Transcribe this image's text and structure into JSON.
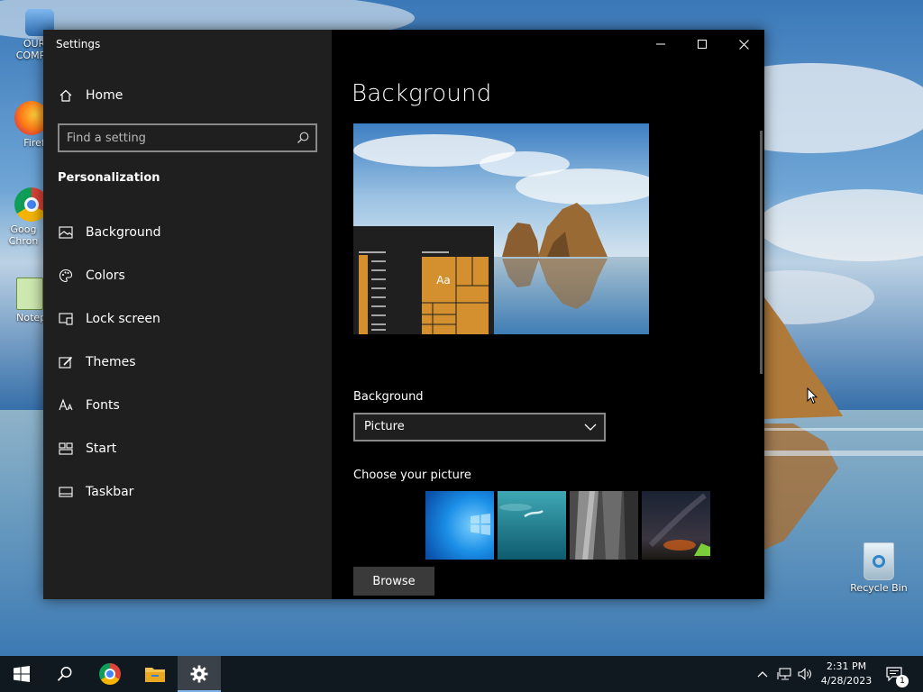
{
  "window": {
    "title": "Settings",
    "minimize_icon": "minimize-icon",
    "maximize_icon": "maximize-icon",
    "close_icon": "close-icon"
  },
  "sidebar": {
    "home": {
      "label": "Home",
      "icon": "home-icon"
    },
    "search": {
      "placeholder": "Find a setting",
      "icon": "search-icon"
    },
    "section_title": "Personalization",
    "items": [
      {
        "label": "Background",
        "icon": "picture-icon",
        "selected": true
      },
      {
        "label": "Colors",
        "icon": "palette-icon"
      },
      {
        "label": "Lock screen",
        "icon": "lock-screen-icon"
      },
      {
        "label": "Themes",
        "icon": "brush-icon"
      },
      {
        "label": "Fonts",
        "icon": "font-icon"
      },
      {
        "label": "Start",
        "icon": "start-tiles-icon"
      },
      {
        "label": "Taskbar",
        "icon": "taskbar-icon"
      }
    ]
  },
  "content": {
    "page_title": "Background",
    "preview": {
      "sample_text": "Aa",
      "accent": "#d4902e"
    },
    "background_label": "Background",
    "background_select": {
      "value": "Picture"
    },
    "choose_picture_label": "Choose your picture",
    "thumbnails": [
      "windows-blue-thumb",
      "underwater-swimmer-thumb",
      "rock-cliff-thumb",
      "night-sky-tent-thumb"
    ],
    "browse_button": "Browse"
  },
  "desktop": {
    "icons": [
      {
        "label": "OUR COMPU",
        "icon": "computer-icon"
      },
      {
        "label": "Firef",
        "icon": "firefox-icon"
      },
      {
        "label": "Goog Chron",
        "icon": "chrome-icon"
      },
      {
        "label": "Notepa",
        "icon": "notepad-icon"
      }
    ],
    "recycle_bin": {
      "label": "Recycle Bin",
      "icon": "recycle-bin-icon"
    }
  },
  "taskbar": {
    "pinned": [
      "windows-start-icon",
      "search-icon",
      "chrome-icon",
      "file-explorer-icon",
      "settings-gear-icon"
    ],
    "active": "settings-gear-icon",
    "time": "2:31 PM",
    "date": "4/28/2023",
    "notification_count": "1"
  },
  "colors": {
    "sidebar_bg": "#1f1f1f",
    "content_bg": "#000000",
    "accent": "#d4902e",
    "taskbar_bg": "#101820"
  }
}
